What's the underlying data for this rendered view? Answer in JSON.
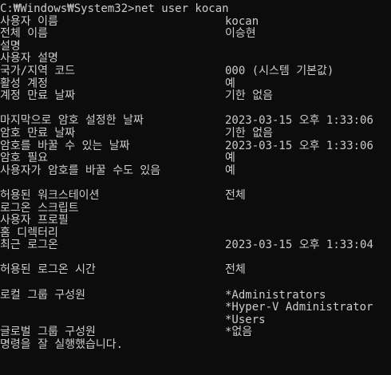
{
  "prompt": "C:₩Windows₩System32>net user kocan",
  "rows": [
    {
      "label": "사용자 이름",
      "value": "kocan"
    },
    {
      "label": "전체 이름",
      "value": "이승현"
    },
    {
      "label": "설명",
      "value": ""
    },
    {
      "label": "사용자 설명",
      "value": ""
    },
    {
      "label": "국가/지역 코드",
      "value": "000 (시스템 기본값)"
    },
    {
      "label": "활성 계정",
      "value": "예"
    },
    {
      "label": "계정 만료 날짜",
      "value": "기한 없음"
    },
    {
      "label": "",
      "value": ""
    },
    {
      "label": "마지막으로 암호 설정한 날짜",
      "value": "2023-03-15 오후 1:33:06"
    },
    {
      "label": "암호 만료 날짜",
      "value": "기한 없음"
    },
    {
      "label": "암호를 바꿀 수 있는 날짜",
      "value": "2023-03-15 오후 1:33:06"
    },
    {
      "label": "암호 필요",
      "value": "예"
    },
    {
      "label": "사용자가 암호를 바꿀 수도 있음",
      "value": "예"
    },
    {
      "label": "",
      "value": ""
    },
    {
      "label": "허용된 워크스테이션",
      "value": "전체"
    },
    {
      "label": "로그온 스크립트",
      "value": ""
    },
    {
      "label": "사용자 프로필",
      "value": ""
    },
    {
      "label": "홈 디렉터리",
      "value": ""
    },
    {
      "label": "최근 로그온",
      "value": "2023-03-15 오후 1:33:04"
    },
    {
      "label": "",
      "value": ""
    },
    {
      "label": "허용된 로그온 시간",
      "value": "전체"
    },
    {
      "label": "",
      "value": ""
    },
    {
      "label": "로컬 그룹 구성원",
      "value": "*Administrators"
    },
    {
      "label": "",
      "value": "*Hyper-V Administrator"
    },
    {
      "label": "",
      "value": "*Users"
    },
    {
      "label": "글로벌 그룹 구성원",
      "value": "*없음"
    }
  ],
  "result": "명령을 잘 실행했습니다."
}
